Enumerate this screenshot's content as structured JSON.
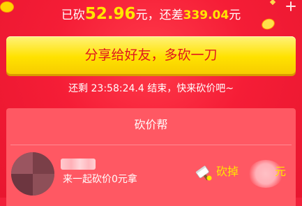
{
  "progress": {
    "prefix": "已砍",
    "cut_amount": "52.96",
    "mid": "元，还差",
    "remaining_amount": "339.04",
    "suffix": "元"
  },
  "share_button": {
    "label": "分享给好友，多砍一刀"
  },
  "countdown": {
    "text": "还剩 23:58:24.4 结束，快来砍价吧~"
  },
  "helpers": {
    "title": "砍价帮",
    "items": [
      {
        "description": "来一起砍价0元拿",
        "cut_label": "砍掉",
        "cut_unit": "元"
      }
    ]
  },
  "colors": {
    "background": "#f2203a",
    "accent_yellow": "#ffe600",
    "button_text": "#e0161e",
    "card": "#ff5863"
  },
  "icons": {
    "cut": "cleaver-knife-icon"
  }
}
